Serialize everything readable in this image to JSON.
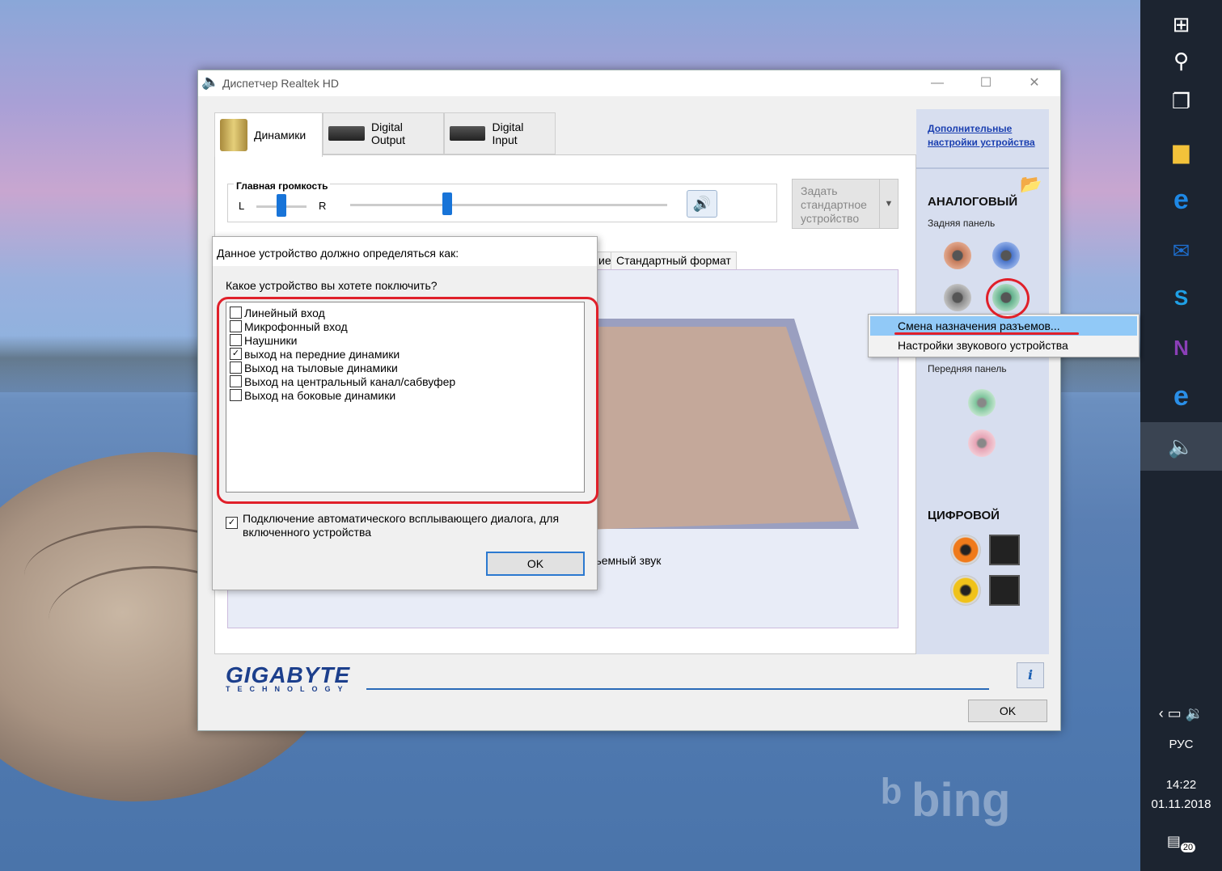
{
  "window": {
    "title": "Диспетчер Realtek HD",
    "minimize": "—",
    "maximize": "☐",
    "close": "✕"
  },
  "tabs": [
    {
      "label": "Динамики",
      "active": true
    },
    {
      "label": "Digital Output",
      "active": false
    },
    {
      "label": "Digital Input",
      "active": false
    }
  ],
  "volume": {
    "title": "Главная громкость",
    "left": "L",
    "right": "R",
    "balance": 0.5,
    "level": 0.3
  },
  "set_default": {
    "label": "Задать стандартное устройство"
  },
  "subtabs": {
    "partial": "ие",
    "format": "Стандартный формат"
  },
  "surround_label": "ъемный звук",
  "side": {
    "link": "Дополнительные настройки устройства",
    "analog_title": "АНАЛОГОВЫЙ",
    "back_panel": "Задняя панель",
    "front_panel": "Передняя панель",
    "digital_title": "ЦИФРОВОЙ"
  },
  "jacks": {
    "back_colors": [
      "#c47a5a",
      "#4a74c9",
      "#8b8b8b",
      "#5fae8a"
    ],
    "front_colors": [
      "#7fc59c",
      "#e6a3b4"
    ]
  },
  "brand": {
    "name": "GIGABYTE",
    "sub": "TECHNOLOGY"
  },
  "main_ok": "OK",
  "info": "i",
  "dialog": {
    "title": "Данное устройство должно определяться как:",
    "question": "Какое устройство вы хотете поключить?",
    "options": [
      {
        "label": "Линейный вход",
        "checked": false
      },
      {
        "label": "Микрофонный вход",
        "checked": false
      },
      {
        "label": "Наушники",
        "checked": false
      },
      {
        "label": "выход на передние динамики",
        "checked": true
      },
      {
        "label": "Выход на тыловые динамики",
        "checked": false
      },
      {
        "label": "Выход на центральный канал/сабвуфер",
        "checked": false
      },
      {
        "label": "Выход на боковые динамики",
        "checked": false
      }
    ],
    "auto_popup": "Подключение автоматического всплывающего диалога, для включенного устройства",
    "auto_popup_checked": true,
    "ok": "OK"
  },
  "context_menu": {
    "items": [
      "Смена назначения разъемов...",
      "Настройки звукового устройства"
    ],
    "highlighted": 0
  },
  "taskbar": {
    "lang": "РУС",
    "time": "14:22",
    "date": "01.11.2018",
    "notifications": "20"
  },
  "wallpaper": {
    "watermark": "bing"
  },
  "colors": {
    "accent": "#1874d8",
    "annotation": "#e0202a",
    "menu_highlight": "#91c9f7",
    "brand": "#1c3f8c"
  }
}
